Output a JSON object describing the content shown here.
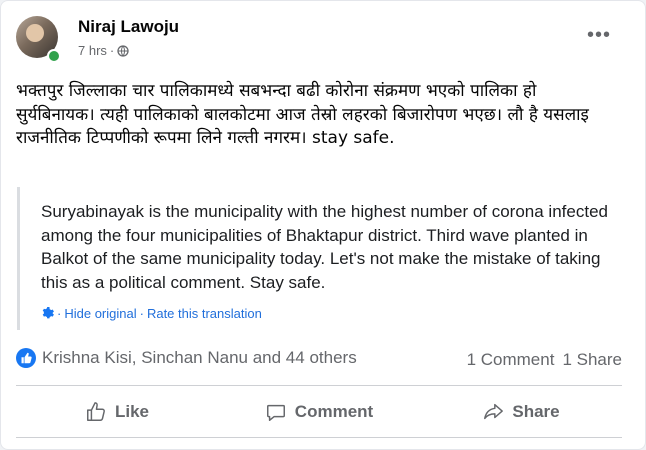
{
  "post": {
    "author": "Niraj Lawoju",
    "time": "7 hrs",
    "separator": "·",
    "privacy_icon": "globe-icon",
    "text": "भक्तपुर जिल्लाका चार पालिकामध्ये सबभन्दा बढी कोरोना संक्रमण भएको पालिका हो सुर्यबिनायक। त्यही पालिकाको बालकोटमा आज तेस्रो लहरको बिजारोपण भएछ। लौ है यसलाइ राजनीतिक टिप्पणीको रूपमा लिने गल्ती नगरम। stay safe.",
    "translation": "Suryabinayak is the municipality with the highest number of corona infected among the four municipalities of Bhaktapur district. Third wave planted in Balkot of the same municipality today. Let's not make the mistake of taking this as a political comment. Stay safe.",
    "hide_original": "Hide original",
    "rate_translation": "Rate this translation",
    "link_separator": "·"
  },
  "reactions": {
    "summary": "Krishna Kisi, Sinchan Nanu and 44 others",
    "comments": "1 Comment",
    "shares": "1 Share"
  },
  "actions": {
    "like": "Like",
    "comment": "Comment",
    "share": "Share"
  },
  "colors": {
    "accent": "#1877f2",
    "link": "#216fdb",
    "secondary_text": "#65676b",
    "online": "#31a24c"
  }
}
